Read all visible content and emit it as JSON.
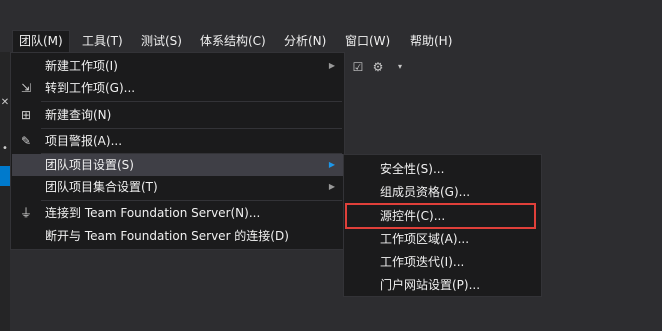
{
  "menubar": {
    "items": [
      {
        "label": "团队(M)",
        "active": true
      },
      {
        "label": "工具(T)"
      },
      {
        "label": "测试(S)"
      },
      {
        "label": "体系结构(C)"
      },
      {
        "label": "分析(N)"
      },
      {
        "label": "窗口(W)"
      },
      {
        "label": "帮助(H)"
      }
    ]
  },
  "team_menu": {
    "items": [
      {
        "label": "新建工作项(I)",
        "icon": "none",
        "has_submenu": true
      },
      {
        "label": "转到工作项(G)...",
        "icon": "goto-workitem-icon"
      },
      {
        "label": "新建查询(N)",
        "icon": "new-query-icon"
      },
      {
        "label": "项目警报(A)...",
        "icon": "alert-icon"
      },
      {
        "label": "团队项目设置(S)",
        "has_submenu": true,
        "highlighted": true
      },
      {
        "label": "团队项目集合设置(T)",
        "has_submenu": true
      },
      {
        "label": "连接到 Team Foundation Server(N)...",
        "icon": "plug-icon"
      },
      {
        "label": "断开与 Team Foundation Server 的连接(D)"
      }
    ]
  },
  "project_settings_submenu": {
    "items": [
      {
        "label": "安全性(S)..."
      },
      {
        "label": "组成员资格(G)..."
      },
      {
        "label": "源控件(C)...",
        "outlined": true
      },
      {
        "label": "工作项区域(A)..."
      },
      {
        "label": "工作项迭代(I)..."
      },
      {
        "label": "门户网站设置(P)..."
      }
    ]
  },
  "colors": {
    "background": "#2d2d30",
    "menu_bg": "#1b1b1c",
    "highlight": "#3f3f46",
    "outline_red": "#e0403a",
    "accent_blue": "#007acc"
  }
}
